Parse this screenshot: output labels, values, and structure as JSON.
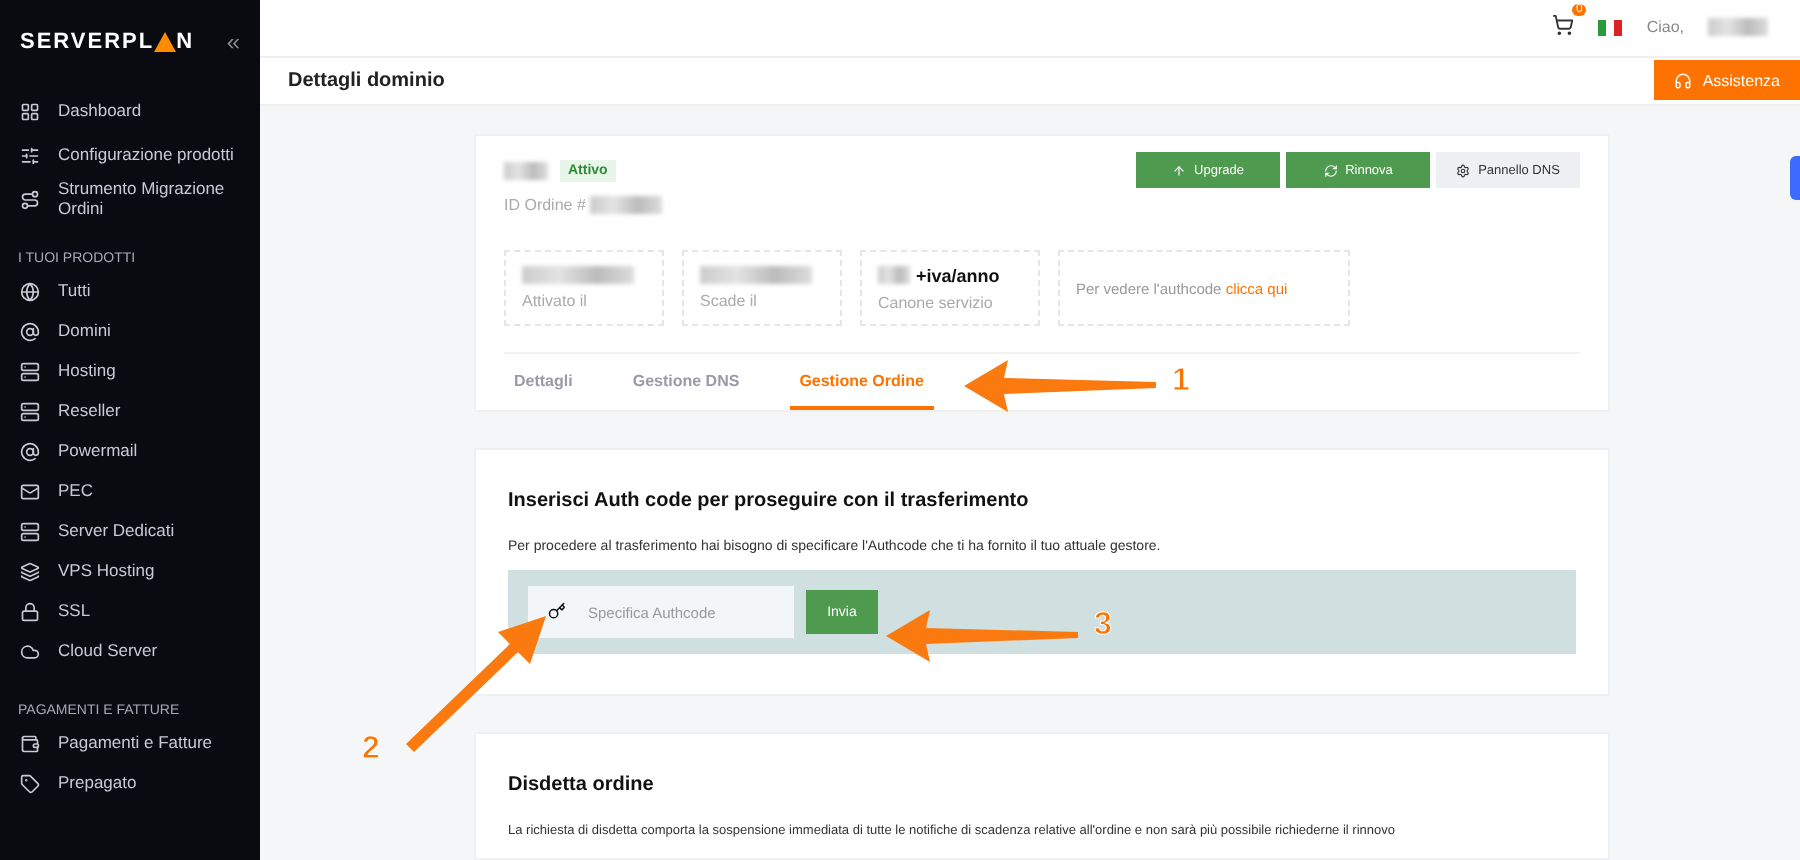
{
  "sidebar": {
    "logo": {
      "left": "SERVERPL",
      "right": "N"
    },
    "collapse": "«",
    "groups": [
      {
        "items": [
          {
            "label": "Dashboard"
          },
          {
            "label": "Configurazione prodotti"
          },
          {
            "label": "Strumento Migrazione Ordini"
          }
        ]
      },
      {
        "title": "I TUOI PRODOTTI",
        "items": [
          {
            "label": "Tutti"
          },
          {
            "label": "Domini"
          },
          {
            "label": "Hosting"
          },
          {
            "label": "Reseller"
          },
          {
            "label": "Powermail"
          },
          {
            "label": "PEC"
          },
          {
            "label": "Server Dedicati"
          },
          {
            "label": "VPS Hosting"
          },
          {
            "label": "SSL"
          },
          {
            "label": "Cloud Server"
          }
        ]
      },
      {
        "title": "PAGAMENTI E FATTURE",
        "items": [
          {
            "label": "Pagamenti e Fatture"
          },
          {
            "label": "Prepagato"
          }
        ]
      }
    ]
  },
  "topbar": {
    "cart_count": "0",
    "greeting": "Ciao,"
  },
  "header": {
    "title": "Dettagli dominio",
    "support_button": "Assistenza"
  },
  "order": {
    "status": "Attivo",
    "order_id_label": "ID Ordine #",
    "actions": [
      {
        "label": "Upgrade",
        "kind": "primary"
      },
      {
        "label": "Rinnova",
        "kind": "primary"
      },
      {
        "label": "Pannello DNS",
        "kind": "secondary"
      }
    ],
    "infos": [
      {
        "caption": "Attivato il",
        "kind": "redacted"
      },
      {
        "caption": "Scade il",
        "kind": "redacted"
      },
      {
        "value": "+iva/anno",
        "caption": "Canone servizio",
        "kind": "price"
      }
    ],
    "authcode_note": {
      "text": "Per vedere l'authcode",
      "link": "clicca qui"
    },
    "tabs": [
      {
        "label": "Dettagli",
        "selected": false
      },
      {
        "label": "Gestione DNS",
        "selected": false
      },
      {
        "label": "Gestione Ordine",
        "selected": true
      }
    ]
  },
  "transfer": {
    "title": "Inserisci Auth code per proseguire con il trasferimento",
    "text": "Per procedere al trasferimento hai bisogno di specificare l'Authcode che ti ha fornito il tuo attuale gestore.",
    "placeholder": "Specifica Authcode",
    "button": "Invia"
  },
  "cancel": {
    "title": "Disdetta ordine",
    "text": "La richiesta di disdetta comporta la sospensione immediata di tutte le notifiche di scadenza relative all'ordine e non sarà più possibile richiederne il rinnovo"
  },
  "annotations": [
    {
      "label": "1"
    },
    {
      "label": "2"
    },
    {
      "label": "3"
    }
  ]
}
